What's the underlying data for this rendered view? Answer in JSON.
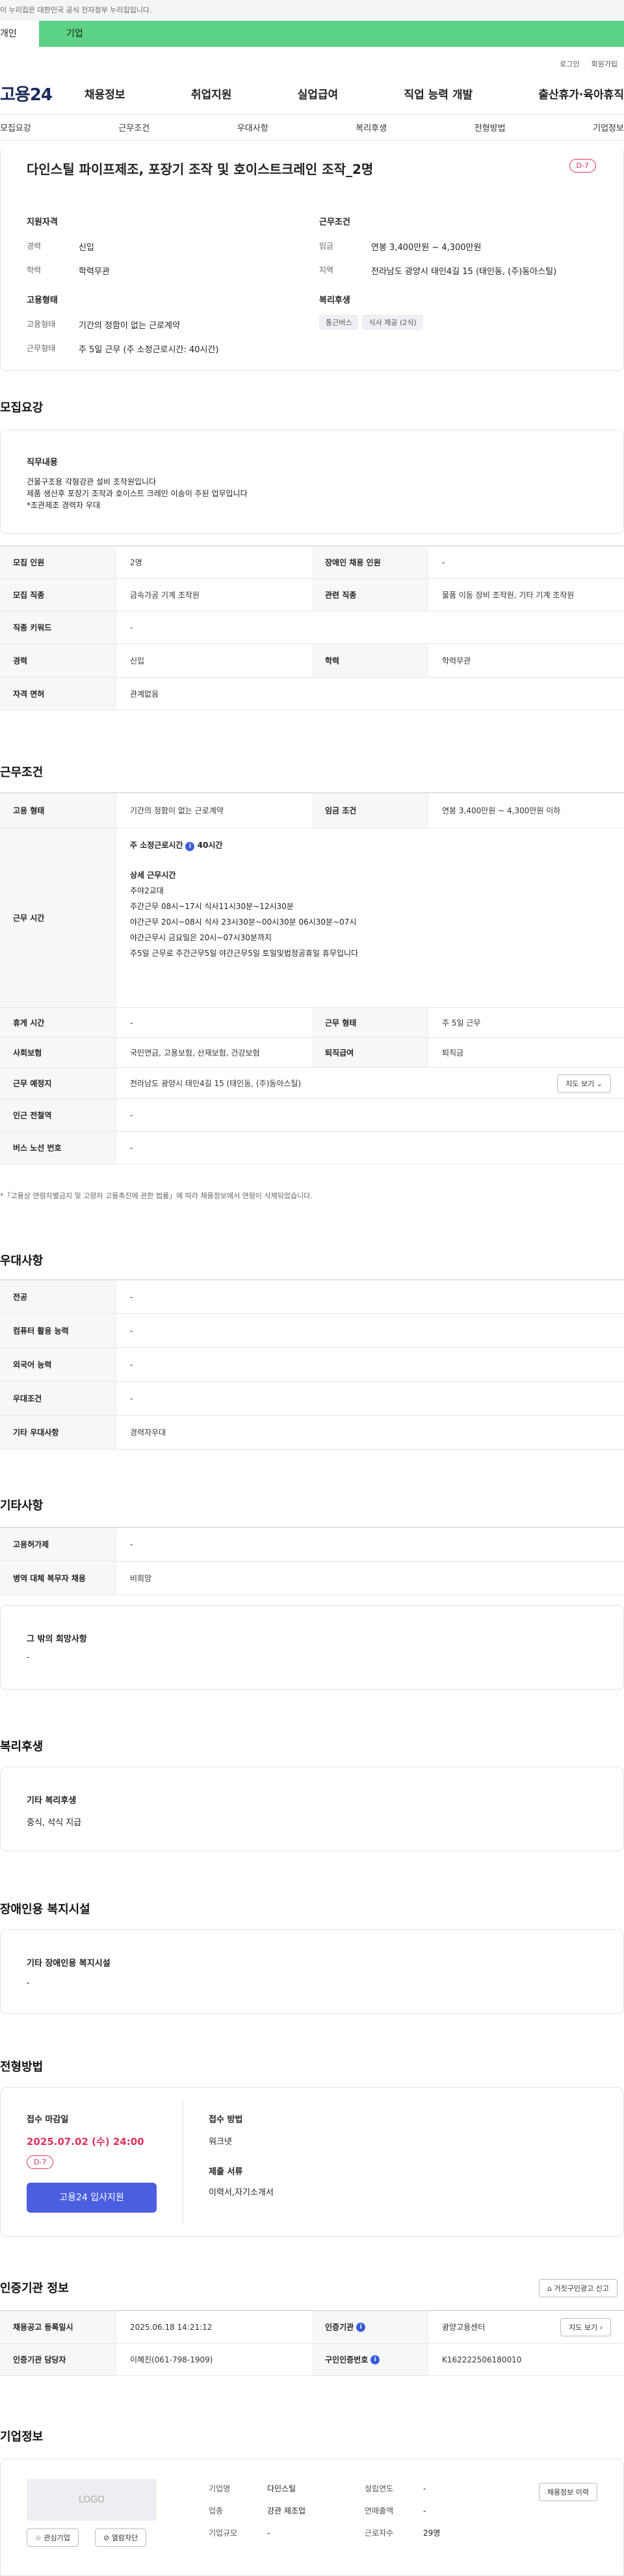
{
  "gov_banner": "이 누리집은 대한민국 공식 전자정부 누리집입니다.",
  "top_tabs": [
    "개인",
    "기업"
  ],
  "util": [
    "로그인",
    "회원가입"
  ],
  "logo": "고용24",
  "gnb": [
    "채용정보",
    "취업지원",
    "실업급여",
    "직업 능력 개발",
    "출산휴가·육아휴직"
  ],
  "subtabs": [
    "모집요강",
    "근무조건",
    "우대사항",
    "복리후생",
    "전형방법",
    "기업정보"
  ],
  "job": {
    "title": "다인스틸 파이프제조, 포장기 조작 및 호이스트크레인 조작_2명",
    "dday": "D-7",
    "qual_title": "지원자격",
    "career_k": "경력",
    "career_v": "신입",
    "edu_k": "학력",
    "edu_v": "학력무관",
    "emp_title": "고용형태",
    "emp_k": "고용형태",
    "emp_v": "기간의 정함이 없는 근로계약",
    "hours_k": "근무형태",
    "hours_v": "주 5일 근무 (주 소정근로시간: 40시간)",
    "cond_title": "근무조건",
    "wage_k": "임금",
    "wage_v": "연봉 3,400만원 ~ 4,300만원",
    "loc_k": "지역",
    "loc_v": "전라남도 광양시 태인4길 15 (태인동, (주)동아스틸)",
    "welfare_title": "복리후생",
    "welfare": [
      "통근버스",
      "식사 제공 (2식)"
    ]
  },
  "recruit": {
    "title": "모집요강",
    "duty_title": "직무내용",
    "duty": [
      "건물구조용 각형강관 설비 조작원입니다",
      "제품 생산후 포장기 조작과 호이스트 크레인 이송이 주된 업무입니다",
      "*조관제조 경력자 우대"
    ],
    "rows": [
      [
        "모집 인원",
        "2명",
        "장애인 채용 인원",
        "-"
      ],
      [
        "모집 직종",
        "금속가공 기계 조작원",
        "관련 직종",
        "물품 이동 장비 조작원, 기타 기계 조작원"
      ],
      [
        "직종 키워드",
        "-"
      ],
      [
        "경력",
        "신입",
        "학력",
        "학력무관"
      ],
      [
        "자격 면허",
        "관계없음"
      ]
    ]
  },
  "work": {
    "title": "근무조건",
    "emp_k": "고용 형태",
    "emp_v": "기간의 정함이 없는 근로계약",
    "wage_k": "임금 조건",
    "wage_v": "연봉 3,400만원 ~ 4,300만원 이하",
    "time_k": "근무 시간",
    "time_main": "주 소정근로시간",
    "time_hours": "40시간",
    "time_detail_title": "상세 근무시간",
    "time_lines": [
      "주야2교대",
      "주간근무 08시~17시 식사11시30분~12시30분",
      "야간근무 20시~08시 식사 23시30분~00시30분  06시30분~07시",
      "야간근무시 금요일은 20시~07시30분까지",
      "주5일 근무로 주간근무5일 야간근무5일 토일및법정공휴일 휴무입니다"
    ],
    "rows": [
      [
        "휴게 시간",
        "-",
        "근무 형태",
        "주 5일 근무"
      ],
      [
        "사회보험",
        "국민연금, 고용보험, 산재보험, 건강보험",
        "퇴직급여",
        "퇴직금"
      ]
    ],
    "place_k": "근무 예정지",
    "place_v": "전라남도 광양시 태인4길 15 (태인동, (주)동아스틸)",
    "map_btn": "지도 보기",
    "rows2": [
      [
        "인근 전철역",
        "-"
      ],
      [
        "버스 노선 번호",
        "-"
      ]
    ],
    "note": "*「고용상 연령차별금지 및 고령자 고용촉진에 관한 법률」에 따라 채용정보에서 연령이 삭제되었습니다."
  },
  "pref": {
    "title": "우대사항",
    "rows": [
      [
        "전공",
        "-"
      ],
      [
        "컴퓨터 활용 능력",
        "-"
      ],
      [
        "외국어 능력",
        "-"
      ],
      [
        "우대조건",
        "-"
      ],
      [
        "기타 우대사항",
        "경력자우대"
      ]
    ]
  },
  "etc": {
    "title": "기타사항",
    "rows": [
      [
        "고용허가제",
        "-"
      ],
      [
        "병역 대체 복무자 채용",
        "비희망"
      ]
    ],
    "hope_title": "그 밖의 희망사항",
    "hope_v": "-"
  },
  "benefit": {
    "title": "복리후생",
    "box_title": "기타 복리후생",
    "box_v": "중식, 석식 지급"
  },
  "disab": {
    "title": "장애인용 복지시설",
    "box_title": "기타 장애인용 복지시설",
    "box_v": "-"
  },
  "process": {
    "title": "전형방법",
    "deadline_title": "접수 마감일",
    "deadline": "2025.07.02 (수) 24:00",
    "dday": "D-7",
    "apply_btn": "고용24 입사지원",
    "method_title": "접수 방법",
    "method_v": "워크넷",
    "docs_title": "제출 서류",
    "docs_v": "이력서,자기소개서"
  },
  "cert": {
    "title": "인증기관 정보",
    "report_btn": "거짓구인광고 신고",
    "rows": [
      [
        "채용공고 등록일시",
        "2025.06.18 14:21:12",
        "인증기관",
        "광양고용센터"
      ],
      [
        "인증기관 담당자",
        "이혜진(061-798-1909)",
        "구인인증번호",
        "K162222506180010"
      ]
    ],
    "map_btn": "지도 보기"
  },
  "company": {
    "title": "기업정보",
    "logo": "LOGO",
    "fav_btn": "관심기업",
    "block_btn": "열람차단",
    "history_btn": "채용정보 이력",
    "name_k": "기업명",
    "name_v": "다인스틸",
    "year_k": "설립연도",
    "year_v": "-",
    "ind_k": "업종",
    "ind_v": "강관 제조업",
    "sales_k": "연매출액",
    "sales_v": "-",
    "size_k": "기업규모",
    "size_v": "-",
    "emp_k": "근로자수",
    "emp_v": "29명"
  }
}
